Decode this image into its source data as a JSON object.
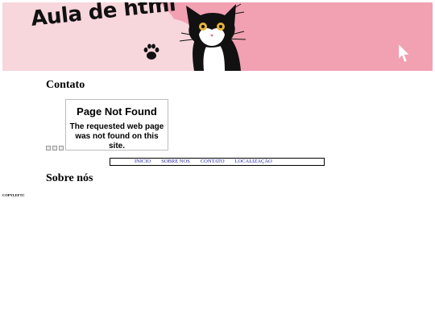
{
  "banner": {
    "title": "Aula de html",
    "colors": {
      "background": "#f1a1b2",
      "blob": "#f7d6dc"
    },
    "icons": [
      "paw-icon",
      "cat-illustration",
      "cursor-icon"
    ]
  },
  "sections": {
    "contato_heading": "Contato",
    "sobre_heading": "Sobre nós"
  },
  "embedded_frame": {
    "title": "Page Not Found",
    "message": "The requested web page was not found on this site."
  },
  "nav": {
    "items": [
      "INICIO",
      "SOBRE NOS",
      "CONTATO",
      "LOCALIZAÇÃO"
    ],
    "link_color": "#1a1aa6"
  },
  "footer": {
    "copyright": "COPYLEFTC"
  }
}
